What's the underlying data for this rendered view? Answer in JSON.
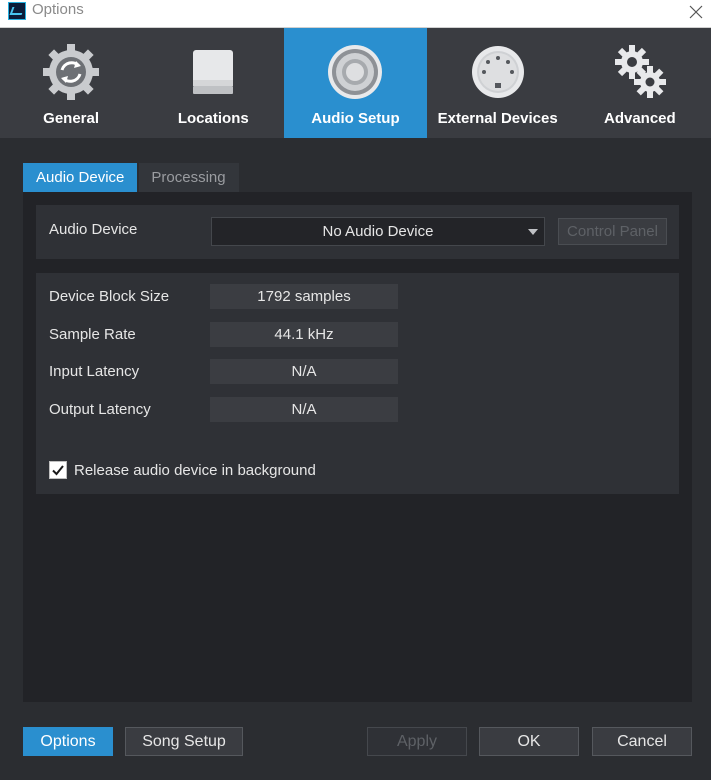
{
  "window": {
    "title": "Options",
    "close_glyph": "✕"
  },
  "categories": [
    {
      "label": "General",
      "icon": "gear-refresh-icon",
      "active": false
    },
    {
      "label": "Locations",
      "icon": "drive-icon",
      "active": false
    },
    {
      "label": "Audio Setup",
      "icon": "speaker-icon",
      "active": true
    },
    {
      "label": "External Devices",
      "icon": "midi-connector-icon",
      "active": false
    },
    {
      "label": "Advanced",
      "icon": "gears-icon",
      "active": false
    }
  ],
  "tabs": {
    "audio_device": "Audio Device",
    "processing": "Processing"
  },
  "audio_device": {
    "label": "Audio Device",
    "selected": "No Audio Device",
    "control_panel": "Control Panel"
  },
  "info": {
    "block_size_label": "Device Block Size",
    "block_size_value": "1792 samples",
    "sample_rate_label": "Sample Rate",
    "sample_rate_value": "44.1 kHz",
    "input_latency_label": "Input Latency",
    "input_latency_value": "N/A",
    "output_latency_label": "Output Latency",
    "output_latency_value": "N/A"
  },
  "release_checkbox": {
    "label": "Release audio device in background",
    "checked": true
  },
  "footer": {
    "options": "Options",
    "song_setup": "Song Setup",
    "apply": "Apply",
    "ok": "OK",
    "cancel": "Cancel"
  },
  "colors": {
    "accent": "#2a8fcf",
    "background": "#2b2d31",
    "category_bar": "#3a3c41"
  }
}
